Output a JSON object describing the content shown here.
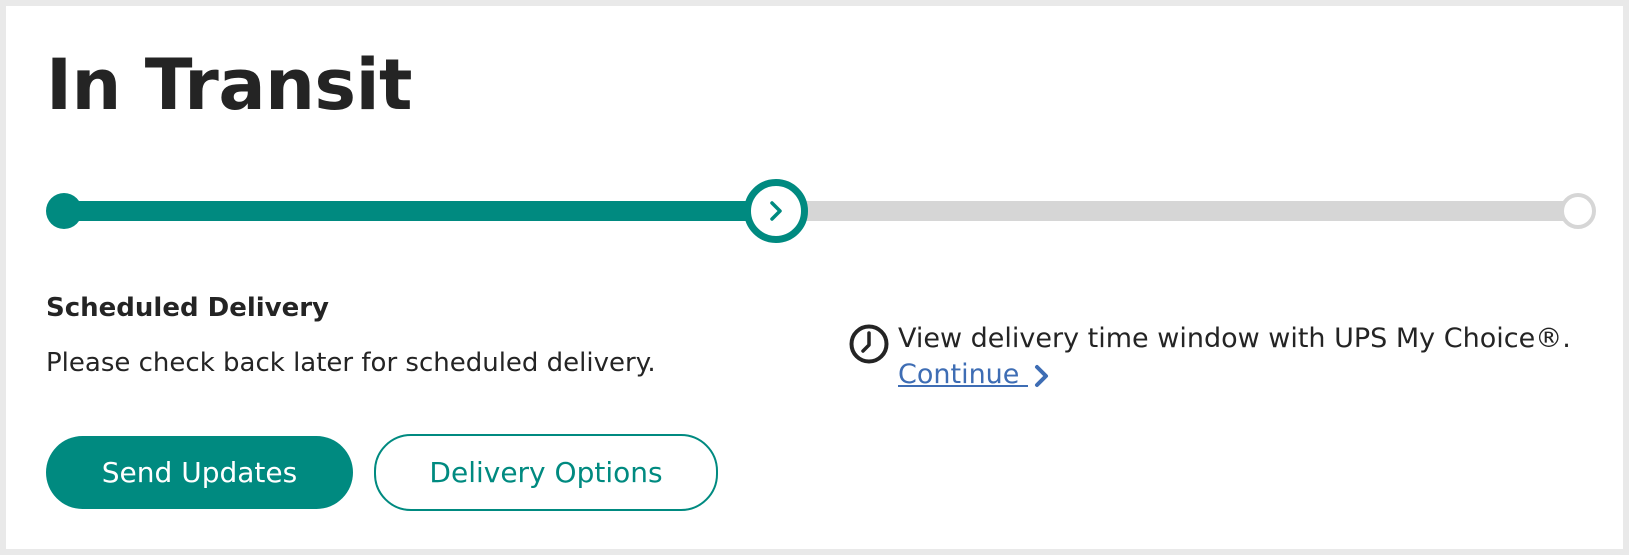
{
  "status": {
    "title": "In Transit"
  },
  "progress": {
    "current_step": 2,
    "total_steps": 3,
    "fraction": 0.47,
    "colors": {
      "complete": "#008a80",
      "incomplete": "#d6d6d6"
    },
    "current_icon": "chevron-right-icon"
  },
  "scheduled_delivery": {
    "heading": "Scheduled Delivery",
    "message": "Please check back later for scheduled delivery."
  },
  "my_choice": {
    "icon": "clock-icon",
    "text": "View delivery time window with UPS My Choice®.",
    "link_label": "Continue ",
    "link_icon": "chevron-right-icon",
    "link_color": "#3e6db4"
  },
  "actions": {
    "send_updates_label": "Send Updates",
    "delivery_options_label": "Delivery Options"
  },
  "colors": {
    "brand": "#008a80",
    "text": "#242424"
  }
}
